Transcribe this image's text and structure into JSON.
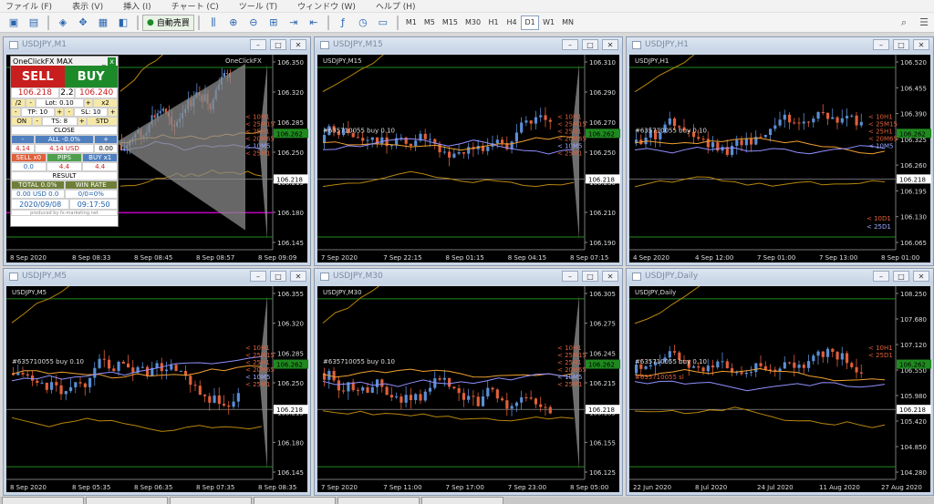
{
  "menu": [
    "ファイル (F)",
    "表示 (V)",
    "挿入 (I)",
    "チャート (C)",
    "ツール (T)",
    "ウィンドウ (W)",
    "ヘルプ (H)"
  ],
  "toolbar": {
    "autotrade": "自動売買",
    "timeframes": [
      "M1",
      "M5",
      "M15",
      "M30",
      "H1",
      "H4",
      "D1",
      "W1",
      "MN"
    ],
    "active_tf": "D1"
  },
  "colors": {
    "bull": "#5b8fd6",
    "bear": "#e0603a",
    "bg": "#000000",
    "grid": "#2a2a2a",
    "level": "#1f8a1f",
    "magenta": "#c000c0",
    "price_box": "#ffffff"
  },
  "windows": [
    {
      "title": "USDJPY,M1",
      "label": "",
      "y_ticks": [
        "106.350",
        "106.320",
        "106.285",
        "106.250",
        "106.215",
        "106.180",
        "106.145"
      ],
      "x_ticks": [
        "8 Sep 2020",
        "8 Sep 08:33",
        "8 Sep 08:45",
        "8 Sep 08:57",
        "8 Sep 09:09"
      ],
      "price": "106.218",
      "corner": "OneClickFX",
      "ma_labels": [
        "< 10H1",
        "< 25M15",
        "< 25H1",
        "< 20M65",
        "< 10M5",
        "< 25M1"
      ],
      "ma_label_colors": [
        "#e0603a",
        "#e0603a",
        "#e0603a",
        "#e0603a",
        "#9aa8ff",
        "#e0603a"
      ],
      "trade_label": "",
      "green_box": "106.262"
    },
    {
      "title": "USDJPY,M15",
      "label": "USDJPY,M15",
      "y_ticks": [
        "106.310",
        "106.290",
        "106.270",
        "106.250",
        "106.230",
        "106.210",
        "106.190"
      ],
      "x_ticks": [
        "7 Sep 2020",
        "7 Sep 22:15",
        "8 Sep 01:15",
        "8 Sep 04:15",
        "8 Sep 07:15"
      ],
      "price": "106.218",
      "corner": "",
      "ma_labels": [
        "< 10H1",
        "< 25M15",
        "< 25H1",
        "< 20M65",
        "< 10M5",
        "< 25M1"
      ],
      "ma_label_colors": [
        "#e0603a",
        "#e0603a",
        "#e0603a",
        "#e0603a",
        "#9aa8ff",
        "#e0603a"
      ],
      "trade_label": "#635710055 buy 0.10",
      "green_box": "106.262"
    },
    {
      "title": "USDJPY,H1",
      "label": "USDJPY,H1",
      "y_ticks": [
        "106.520",
        "106.455",
        "106.390",
        "106.325",
        "106.260",
        "106.195",
        "106.130",
        "106.065"
      ],
      "x_ticks": [
        "4 Sep 2020",
        "4 Sep 12:00",
        "7 Sep 01:00",
        "7 Sep 13:00",
        "8 Sep 01:00"
      ],
      "price": "106.218",
      "corner": "",
      "ma_labels": [
        "< 10H1",
        "< 25M15",
        "< 25H1",
        "< 20M65",
        "< 10M5"
      ],
      "ma_label_colors": [
        "#e0603a",
        "#e0603a",
        "#e0603a",
        "#e0603a",
        "#9aa8ff"
      ],
      "trade_label": "#635710055 buy 0.10",
      "green_box": "106.262",
      "extra_labels": [
        "< 10D1",
        "< 25D1"
      ]
    },
    {
      "title": "USDJPY,M5",
      "label": "USDJPY,M5",
      "y_ticks": [
        "106.355",
        "106.320",
        "106.285",
        "106.250",
        "106.215",
        "106.180",
        "106.145"
      ],
      "x_ticks": [
        "8 Sep 2020",
        "8 Sep 05:35",
        "8 Sep 06:35",
        "8 Sep 07:35",
        "8 Sep 08:35"
      ],
      "price": "106.218",
      "corner": "",
      "ma_labels": [
        "< 10H1",
        "< 25M15",
        "< 25H1",
        "< 20M65",
        "< 10M5",
        "< 25M1"
      ],
      "ma_label_colors": [
        "#e0603a",
        "#e0603a",
        "#e0603a",
        "#e0603a",
        "#9aa8ff",
        "#e0603a"
      ],
      "trade_label": "#635710055 buy 0.10",
      "green_box": "106.262"
    },
    {
      "title": "USDJPY,M30",
      "label": "USDJPY,M30",
      "y_ticks": [
        "106.305",
        "106.275",
        "106.245",
        "106.215",
        "106.185",
        "106.155",
        "106.125"
      ],
      "x_ticks": [
        "7 Sep 2020",
        "7 Sep 11:00",
        "7 Sep 17:00",
        "7 Sep 23:00",
        "8 Sep 05:00"
      ],
      "price": "106.218",
      "corner": "",
      "ma_labels": [
        "< 10H1",
        "< 25M15",
        "< 25H1",
        "< 20M65",
        "< 10M5",
        "< 25M1"
      ],
      "ma_label_colors": [
        "#e0603a",
        "#e0603a",
        "#e0603a",
        "#e0603a",
        "#9aa8ff",
        "#e0603a"
      ],
      "trade_label": "#635710055 buy 0.10",
      "green_box": "106.262"
    },
    {
      "title": "USDJPY,Daily",
      "label": "USDJPY,Daily",
      "y_ticks": [
        "108.250",
        "107.680",
        "107.120",
        "106.550",
        "105.980",
        "105.420",
        "104.850",
        "104.280"
      ],
      "x_ticks": [
        "22 Jun 2020",
        "8 Jul 2020",
        "24 Jul 2020",
        "11 Aug 2020",
        "27 Aug 2020"
      ],
      "price": "106.218",
      "corner": "",
      "ma_labels": [
        "< 10H1",
        "< 25D1"
      ],
      "ma_label_colors": [
        "#e0603a",
        "#e0603a"
      ],
      "trade_label": "#635710055 buy 0.10",
      "trade_label2": "#635710055 sl",
      "green_box": "106.262"
    }
  ],
  "oneclick": {
    "title": "OneClickFX MAX",
    "min": "_",
    "close_x": "x",
    "sell": "SELL",
    "buy": "BUY",
    "bid": "106.218",
    "spread": "2.2",
    "ask": "106.240",
    "div2": "/2",
    "lot_minus": "-",
    "lot": "Lot: 0.10",
    "lot_plus": "+",
    "mul2": "x2",
    "tp_minus": "-",
    "tp": "TP: 10",
    "sl": "SL: 10",
    "sl_plus": "+",
    "tp_plus": "+",
    "sl_minus": "-",
    "on": "ON",
    "ts_minus": "-",
    "ts": "TS: 8",
    "ts_plus": "+",
    "std": "STD",
    "close": "CLOSE",
    "all_minus": "-",
    "all": "ALL -0.0%",
    "all_plus": "+",
    "v1": "4.14",
    "v2": "4.14 USD",
    "v3": "0.00",
    "sellv": "SELL x0",
    "pips": "PIPS",
    "buyv": "BUY x1",
    "p1": "0.0",
    "p2": "4.4",
    "p3": "4.4",
    "result": "RESULT",
    "total": "TOTAL 0.0%",
    "winrate": "WIN RATE",
    "usd": "0.00 USD 0.0",
    "ratio": "0/0=0%",
    "datetime": "2020/09/08",
    "time": "09:17:50",
    "credit": "produced by fx-marketing.net"
  }
}
